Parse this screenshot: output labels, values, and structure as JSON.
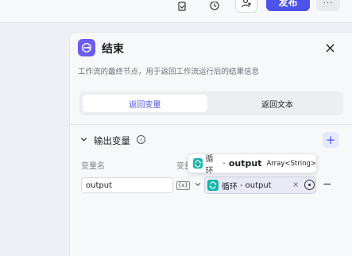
{
  "toolbar": {
    "publish_label": "发布",
    "more_label": "···",
    "icons": [
      "history-doc-icon",
      "clock-icon",
      "user-icon",
      "more-icon"
    ]
  },
  "node": {
    "title": "结束",
    "description": "工作流的最终节点，用于返回工作流运行后的结果信息",
    "close_icon": "close-icon"
  },
  "tabs": [
    {
      "label": "返回变量",
      "active": true
    },
    {
      "label": "返回文本",
      "active": false
    }
  ],
  "output_section": {
    "title": "输出变量",
    "info_glyph": "i",
    "add_label": "+",
    "col_name": "变量名",
    "col_value": "变量值",
    "rows": [
      {
        "name": "output",
        "type_glyph": "{x}",
        "ref_source": "循环",
        "ref_sep": "-",
        "ref_var": "output",
        "clear_label": "×",
        "remove_label": "−"
      }
    ]
  },
  "tooltip": {
    "source": "循环",
    "sep": "-",
    "name": "output",
    "type": "Array<String>"
  },
  "colors": {
    "brand": "#4d53e8",
    "node_icon": "#6b5cf0",
    "loop_icon": "#12b4a8"
  }
}
